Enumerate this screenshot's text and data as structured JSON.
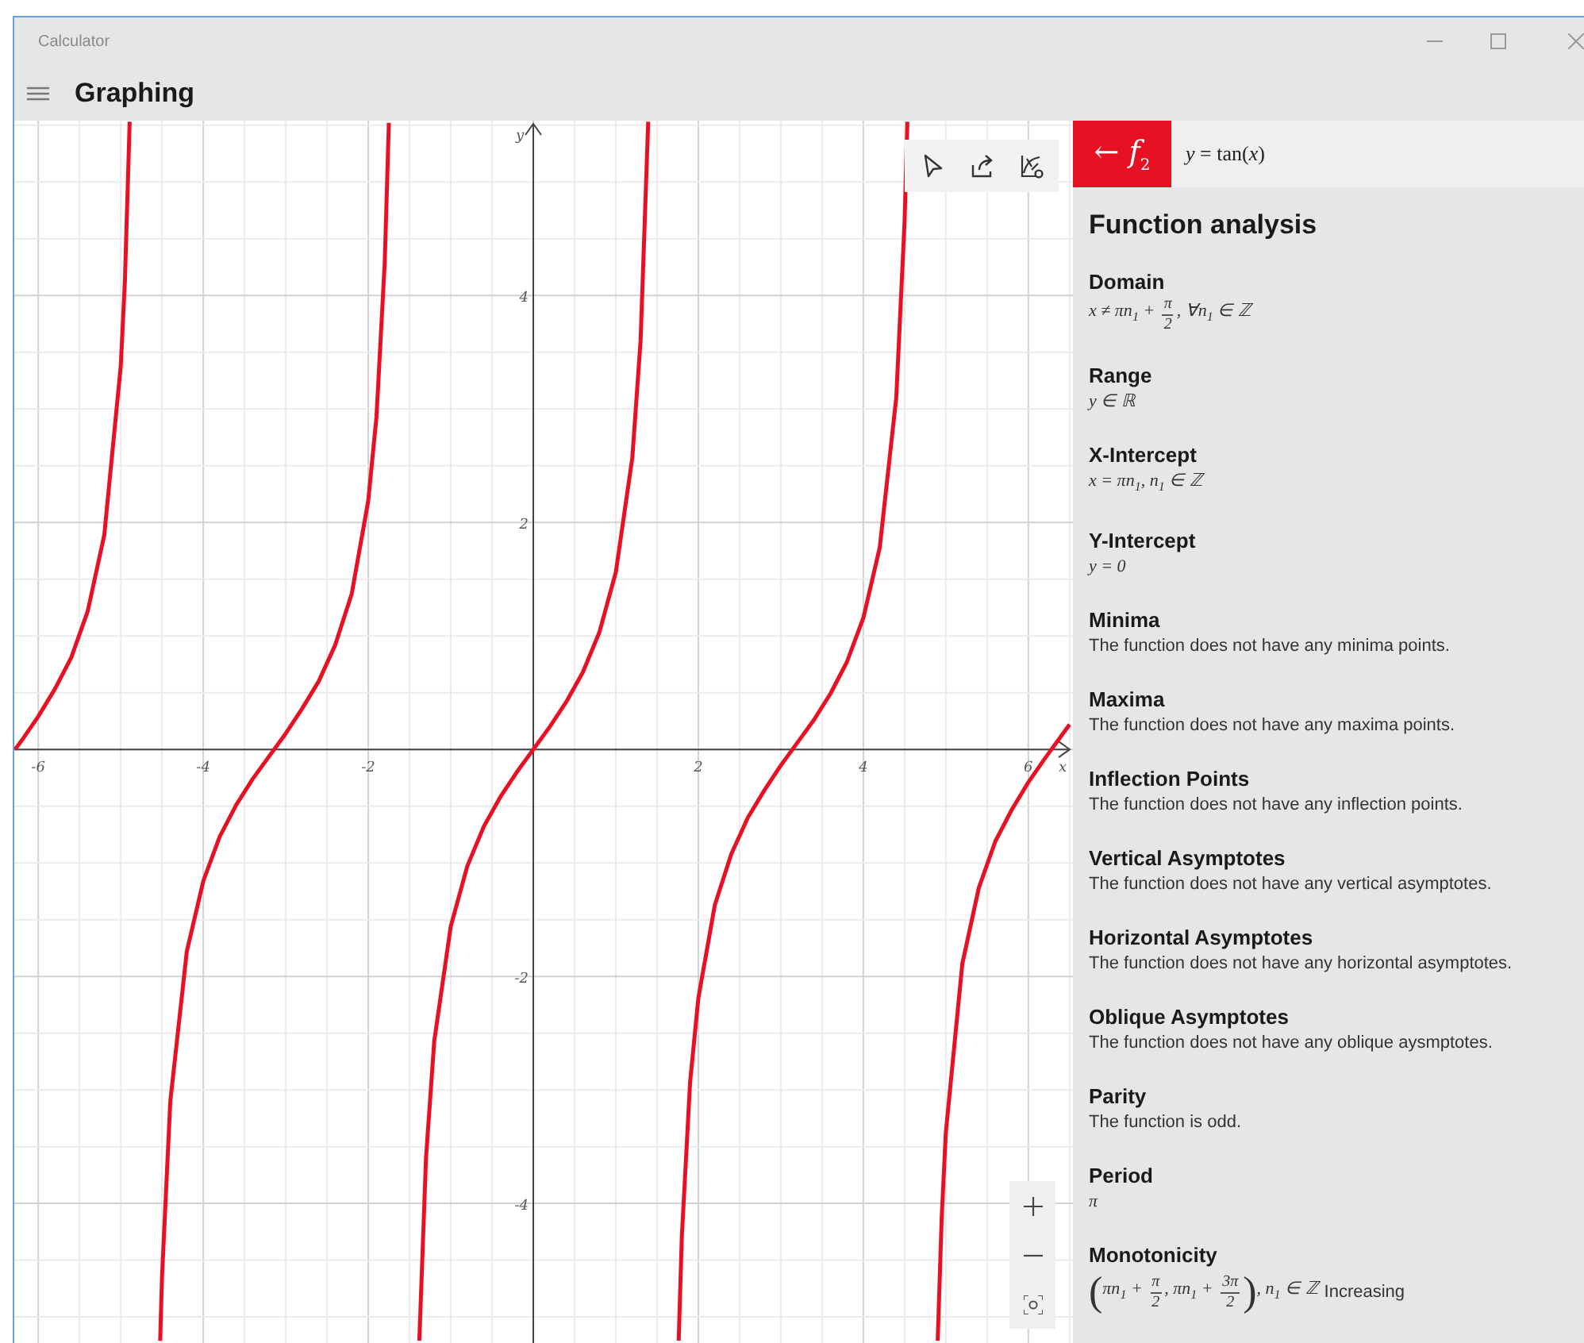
{
  "window": {
    "title": "Calculator"
  },
  "header": {
    "title": "Graphing"
  },
  "graph": {
    "chart_data": {
      "type": "line",
      "xlabel": "x",
      "ylabel": "y",
      "x": [
        -6.28,
        -6.2,
        -6.0,
        -5.8,
        -5.6,
        -5.4,
        -5.2,
        -5.0,
        -4.95,
        -4.891,
        null,
        -4.523,
        -4.5,
        -4.4,
        -4.2,
        -4.0,
        -3.8,
        -3.6,
        -3.4,
        -3.2,
        -3.0,
        -2.8,
        -2.6,
        -2.4,
        -2.2,
        -2.0,
        -1.9,
        -1.8,
        -1.75,
        null,
        -1.381,
        -1.3,
        -1.2,
        -1.0,
        -0.8,
        -0.6,
        -0.4,
        -0.2,
        0,
        0.2,
        0.4,
        0.6,
        0.8,
        1.0,
        1.2,
        1.3,
        1.392,
        null,
        1.761,
        1.8,
        1.9,
        2.0,
        2.2,
        2.4,
        2.6,
        2.8,
        3.0,
        3.2,
        3.4,
        3.6,
        3.8,
        4.0,
        4.2,
        4.4,
        4.5,
        4.534,
        null,
        4.902,
        4.95,
        5.0,
        5.2,
        5.4,
        5.6,
        5.8,
        6.0,
        6.2,
        6.4,
        6.5
      ],
      "series": [
        {
          "color": "#e81123",
          "values": [
            0,
            0.08,
            0.29,
            0.53,
            0.81,
            1.22,
            1.89,
            3.38,
            4.13,
            5.53,
            null,
            -5.21,
            -4.64,
            -3.1,
            -1.78,
            -1.16,
            -0.77,
            -0.49,
            -0.26,
            -0.06,
            0.14,
            0.36,
            0.6,
            0.92,
            1.37,
            2.19,
            2.93,
            4.29,
            5.52,
            null,
            -5.21,
            -3.6,
            -2.57,
            -1.56,
            -1.03,
            -0.68,
            -0.42,
            -0.2,
            0,
            0.2,
            0.42,
            0.68,
            1.03,
            1.56,
            2.57,
            3.6,
            5.53,
            null,
            -5.21,
            -4.29,
            -2.93,
            -2.19,
            -1.37,
            -0.92,
            -0.6,
            -0.36,
            -0.14,
            0.06,
            0.26,
            0.49,
            0.77,
            1.16,
            1.78,
            3.1,
            4.64,
            5.53,
            null,
            -5.21,
            -4.13,
            -3.38,
            -1.89,
            -1.22,
            -0.81,
            -0.53,
            -0.29,
            -0.08,
            0.12,
            0.22
          ]
        }
      ],
      "xlim": [
        -6.29,
        6.54
      ],
      "ylim": [
        -5.23,
        5.54
      ],
      "xticks": [
        -6,
        -4,
        -2,
        2,
        4,
        6
      ],
      "yticks": [
        -4,
        -2,
        2,
        4
      ],
      "grid": true
    }
  },
  "panel": {
    "function_button": {
      "label": "← *f*$_{2}$"
    },
    "equation": "*y* = tan(*x*)",
    "heading": "Function analysis",
    "sections": [
      {
        "title": "Domain",
        "value": [
          {
            "kind": "math",
            "text": "x ≠ πn$_{1}$ + "
          },
          {
            "kind": "frac",
            "num": "π",
            "den": "2"
          },
          {
            "kind": "math",
            "text": ", ∀n$_{1}$ ∈ ℤ"
          }
        ]
      },
      {
        "title": "Range",
        "value": [
          {
            "kind": "math",
            "text": "y ∈ ℝ"
          }
        ]
      },
      {
        "title": "X-Intercept",
        "value": [
          {
            "kind": "math",
            "text": "x = πn$_{1}$, n$_{1}$ ∈ ℤ"
          }
        ]
      },
      {
        "title": "Y-Intercept",
        "value": [
          {
            "kind": "math",
            "text": "y = 0"
          }
        ]
      },
      {
        "title": "Minima",
        "value": [
          {
            "kind": "plain",
            "text": "The function does not have any minima points."
          }
        ]
      },
      {
        "title": "Maxima",
        "value": [
          {
            "kind": "plain",
            "text": "The function does not have any maxima points."
          }
        ]
      },
      {
        "title": "Inflection Points",
        "value": [
          {
            "kind": "plain",
            "text": "The function does not have any inflection points."
          }
        ]
      },
      {
        "title": "Vertical Asymptotes",
        "value": [
          {
            "kind": "plain",
            "text": "The function does not have any vertical asymptotes."
          }
        ]
      },
      {
        "title": "Horizontal Asymptotes",
        "value": [
          {
            "kind": "plain",
            "text": "The function does not have any horizontal asymptotes."
          }
        ]
      },
      {
        "title": "Oblique Asymptotes",
        "value": [
          {
            "kind": "plain",
            "text": "The function does not have any oblique aysmptotes."
          }
        ]
      },
      {
        "title": "Parity",
        "value": [
          {
            "kind": "plain",
            "text": "The function is odd."
          }
        ]
      },
      {
        "title": "Period",
        "value": [
          {
            "kind": "math",
            "text": "π"
          }
        ]
      },
      {
        "title": "Monotonicity",
        "value": [
          {
            "kind": "big",
            "text": "("
          },
          {
            "kind": "math",
            "text": "πn$_{1}$ + "
          },
          {
            "kind": "frac",
            "num": "π",
            "den": "2"
          },
          {
            "kind": "math",
            "text": ", πn$_{1}$ + "
          },
          {
            "kind": "frac",
            "num": "3π",
            "den": "2"
          },
          {
            "kind": "big",
            "text": ")"
          },
          {
            "kind": "math",
            "text": ", n$_{1}$ ∈ ℤ"
          },
          {
            "kind": "plain",
            "text": "Increasing"
          }
        ]
      }
    ]
  }
}
